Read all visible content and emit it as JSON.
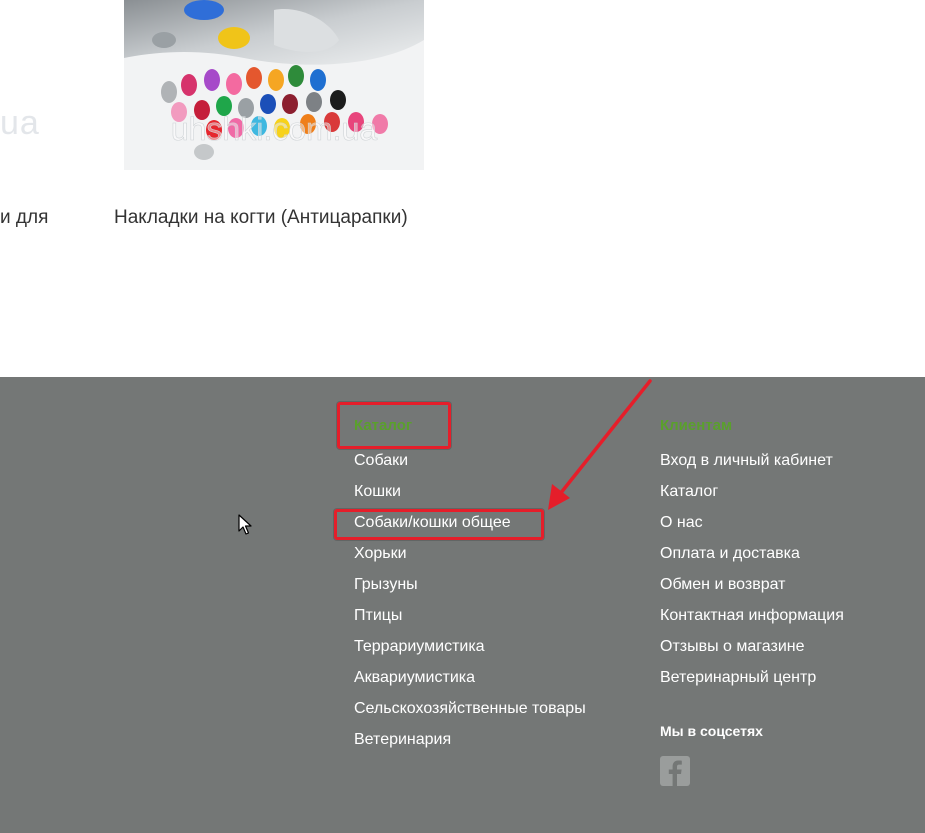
{
  "products": {
    "left_watermark": "ua",
    "left_caption": "и для",
    "item": {
      "image_watermark": "uhshki.com.ua",
      "title": "Накладки на когти (Антицарапки)"
    }
  },
  "footer": {
    "catalog": {
      "heading": "Каталог",
      "links": [
        "Собаки",
        "Кошки",
        "Собаки/кошки общее",
        "Хорьки",
        "Грызуны",
        "Птицы",
        "Террариумистика",
        "Аквариумистика",
        "Сельскохозяйственные товары",
        "Ветеринария"
      ]
    },
    "clients": {
      "heading": "Клиентам",
      "links": [
        "Вход в личный кабинет",
        "Каталог",
        "О нас",
        "Оплата и доставка",
        "Обмен и возврат",
        "Контактная информация",
        "Отзывы о магазине",
        "Ветеринарный центр"
      ]
    },
    "social": {
      "title": "Мы в соцсетях",
      "icons": [
        "facebook-icon"
      ]
    }
  },
  "colors": {
    "footer_bg": "#747776",
    "heading_green": "#5aa02c",
    "annotation_red": "#e51e2a",
    "link_white": "#ffffff"
  }
}
